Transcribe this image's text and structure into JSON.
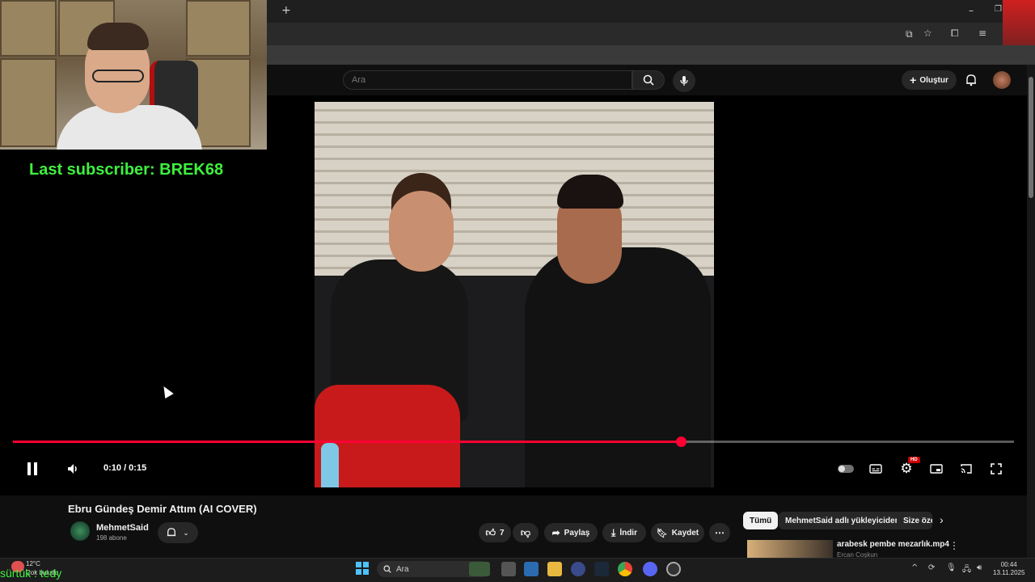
{
  "overlay": {
    "last_subscriber": "Last subscriber: BREK68",
    "bottom_text": "sürtük : tedy"
  },
  "browser": {
    "new_tab_icon": "plus-icon"
  },
  "header": {
    "search_placeholder": "Ara",
    "create_label": "Oluştur"
  },
  "player": {
    "time_display": "0:10 / 0:15",
    "progress": 0.667,
    "hd_badge": "HD",
    "accent": "#ff0033"
  },
  "video": {
    "title": "Ebru Gündeş Demir Attım (AI COVER)",
    "channel": "MehmetSaid",
    "subscribers": "198 abone",
    "likes": "7",
    "share_label": "Paylaş",
    "download_label": "İndir",
    "save_label": "Kaydet"
  },
  "chips": [
    {
      "label": "Tümü"
    },
    {
      "label": "MehmetSaid adlı yükleyiciden"
    },
    {
      "label": "Size öze"
    }
  ],
  "recommended": {
    "title": "arabesk pembe mezarlık.mp4",
    "author": "Ercan Coşkun"
  },
  "taskbar": {
    "search_label": "Ara",
    "weather_temp": "12°C",
    "weather_desc": "Çok bulutlu",
    "time": "00:44",
    "date": "13.11.2025"
  }
}
